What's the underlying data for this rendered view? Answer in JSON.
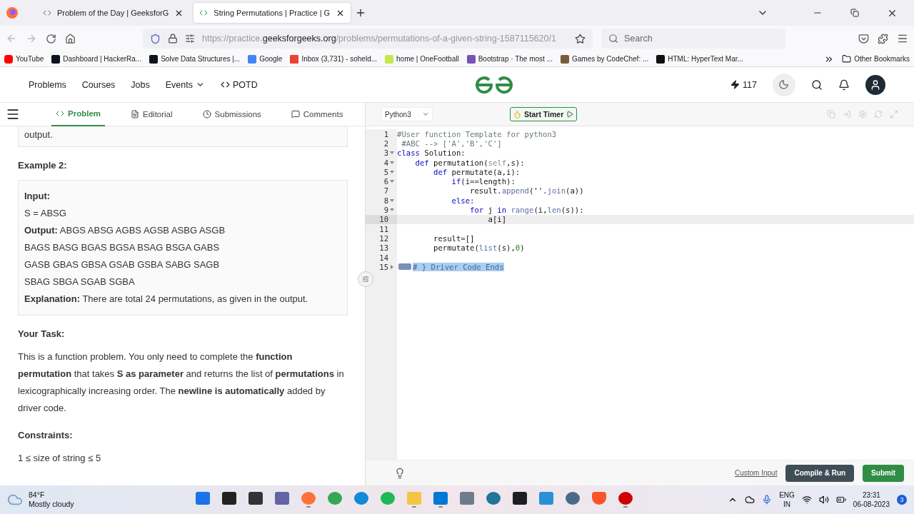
{
  "browser": {
    "tabs": [
      {
        "title": "Problem of the Day | GeeksforG",
        "selected": false
      },
      {
        "title": "String Permutations | Practice | G",
        "selected": true
      }
    ],
    "url": {
      "scheme": "https://practice.",
      "domain": "geeksforgeeks.org",
      "path": "/problems/permutations-of-a-given-string-1587115620/1"
    },
    "search_placeholder": "Search",
    "bookmarks": [
      {
        "label": "YouTube",
        "color": "#ff0000",
        "kind": "play"
      },
      {
        "label": "Dashboard | HackerRa...",
        "color": "#0e141e",
        "kind": "letter"
      },
      {
        "label": "Solve Data Structures |...",
        "color": "#0e141e",
        "kind": "letter"
      },
      {
        "label": "Google",
        "color": "#4285f4",
        "kind": "letter"
      },
      {
        "label": "Inbox (3,731) - soheld...",
        "color": "#ea4335",
        "kind": "mail"
      },
      {
        "label": "home | OneFootball",
        "color": "#c6e84a",
        "kind": "letter"
      },
      {
        "label": "Bootstrap · The most ...",
        "color": "#7952b3",
        "kind": "letter"
      },
      {
        "label": "Games by CodeChef: ...",
        "color": "#7b5a3a",
        "kind": "letter"
      },
      {
        "label": "HTML: HyperText Mar...",
        "color": "#111111",
        "kind": "letter"
      }
    ],
    "other_bookmarks": "Other Bookmarks"
  },
  "site_nav": {
    "links": [
      {
        "label": "Problems",
        "dropdown": false
      },
      {
        "label": "Courses",
        "dropdown": false
      },
      {
        "label": "Jobs",
        "dropdown": false
      },
      {
        "label": "Events",
        "dropdown": true
      },
      {
        "label": "POTD",
        "dropdown": false
      }
    ],
    "streak": "117"
  },
  "problem_tabs": [
    {
      "label": "Problem",
      "selected": true
    },
    {
      "label": "Editorial",
      "selected": false
    },
    {
      "label": "Submissions",
      "selected": false
    },
    {
      "label": "Comments",
      "selected": false
    }
  ],
  "problem": {
    "top_cut": "output.",
    "example_title": "Example 2:",
    "example": {
      "input_label": "Input:",
      "input": "S = ABSG",
      "output_label": "Output:",
      "output_lines": [
        "ABGS ABSG AGBS AGSB ASBG ASGB",
        "BAGS BASG BGAS BGSA BSAG BSGA GABS",
        "GASB GBAS GBSA GSAB GSBA SABG SAGB",
        "SBAG SBGA SGAB SGBA"
      ],
      "explanation_label": "Explanation:",
      "explanation": "There are total 24 permutations, as given in the output."
    },
    "task_title": "Your Task:",
    "task": "This is a function problem. You only need to complete the **function permutation** that takes **S as parameter** and returns the list of **permutations** in lexicographically increasing order. The **newline is automatically** added by driver code.",
    "constraints_title": "Constraints:",
    "constraint": "1 ≤ size of string ≤ 5"
  },
  "editor": {
    "language": "Python3",
    "timer": "Start Timer",
    "lines": [
      {
        "n": "1",
        "foldable": false,
        "active": false,
        "tokens": [
          {
            "kind": "comment",
            "t": "#User function Template for python3"
          }
        ]
      },
      {
        "n": "2",
        "foldable": false,
        "active": false,
        "tokens": [
          {
            "kind": "comment",
            "t": " #ABC --> ['A','B','C']"
          }
        ]
      },
      {
        "n": "3",
        "foldable": true,
        "folded": false,
        "active": false,
        "tokens": [
          {
            "kind": "keyword",
            "t": "class"
          },
          {
            "kind": "plain",
            "t": " Solution:"
          }
        ]
      },
      {
        "n": "4",
        "foldable": true,
        "folded": false,
        "active": false,
        "tokens": [
          {
            "kind": "keyword",
            "t": "    def"
          },
          {
            "kind": "plain",
            "t": " permutation("
          },
          {
            "kind": "self",
            "t": "self"
          },
          {
            "kind": "plain",
            "t": ",s):"
          }
        ]
      },
      {
        "n": "5",
        "foldable": true,
        "folded": false,
        "active": false,
        "tokens": [
          {
            "kind": "keyword",
            "t": "        def"
          },
          {
            "kind": "plain",
            "t": " permutate(a,i):"
          }
        ]
      },
      {
        "n": "6",
        "foldable": true,
        "folded": false,
        "active": false,
        "tokens": [
          {
            "kind": "keyword",
            "t": "            if"
          },
          {
            "kind": "plain",
            "t": "(i"
          },
          {
            "kind": "operator",
            "t": "=="
          },
          {
            "kind": "plain",
            "t": "length):"
          }
        ]
      },
      {
        "n": "7",
        "foldable": false,
        "active": false,
        "tokens": [
          {
            "kind": "plain",
            "t": "                result."
          },
          {
            "kind": "builtin",
            "t": "append"
          },
          {
            "kind": "plain",
            "t": "(''."
          },
          {
            "kind": "builtin",
            "t": "join"
          },
          {
            "kind": "plain",
            "t": "(a))"
          }
        ]
      },
      {
        "n": "8",
        "foldable": true,
        "folded": false,
        "active": false,
        "tokens": [
          {
            "kind": "keyword",
            "t": "            else"
          },
          {
            "kind": "plain",
            "t": ":"
          }
        ]
      },
      {
        "n": "9",
        "foldable": true,
        "folded": false,
        "active": false,
        "tokens": [
          {
            "kind": "keyword",
            "t": "                for"
          },
          {
            "kind": "plain",
            "t": " j "
          },
          {
            "kind": "keyword",
            "t": "in"
          },
          {
            "kind": "builtin",
            "t": " range"
          },
          {
            "kind": "plain",
            "t": "(i,"
          },
          {
            "kind": "builtin",
            "t": "len"
          },
          {
            "kind": "plain",
            "t": "(s)):"
          }
        ]
      },
      {
        "n": "10",
        "foldable": false,
        "active": true,
        "tokens": [
          {
            "kind": "plain",
            "t": "                    a[i]"
          }
        ]
      },
      {
        "n": "11",
        "foldable": false,
        "active": false
      },
      {
        "n": "12",
        "foldable": false,
        "active": false,
        "tokens": [
          {
            "kind": "plain",
            "t": "        result"
          },
          {
            "kind": "operator",
            "t": "="
          },
          {
            "kind": "plain",
            "t": "[]"
          }
        ]
      },
      {
        "n": "13",
        "foldable": false,
        "active": false,
        "tokens": [
          {
            "kind": "plain",
            "t": "        permutate("
          },
          {
            "kind": "builtin",
            "t": "list"
          },
          {
            "kind": "plain",
            "t": "(s),"
          },
          {
            "kind": "number",
            "t": "0"
          },
          {
            "kind": "plain",
            "t": ")"
          }
        ]
      },
      {
        "n": "14",
        "foldable": false,
        "active": false
      },
      {
        "n": "15",
        "foldable": true,
        "folded": true,
        "active": false,
        "tokens": [
          {
            "kind": "selection",
            "t": "# } Driver Code Ends"
          }
        ]
      }
    ]
  },
  "actions": {
    "custom_input": "Custom Input",
    "compile": "Compile & Run",
    "submit": "Submit"
  },
  "taskbar": {
    "weather": {
      "temp": "84°F",
      "text": "Mostly cloudy"
    },
    "apps": [
      {
        "kind": "start",
        "color": "#1a73e8",
        "running": false
      },
      {
        "kind": "search",
        "color": "#222222",
        "running": false
      },
      {
        "kind": "tasks",
        "color": "#333333",
        "running": false
      },
      {
        "kind": "chat",
        "color": "#6264a7",
        "running": false
      },
      {
        "kind": "browser",
        "color": "#ff7139",
        "running": true
      },
      {
        "kind": "browser",
        "color": "#34a853",
        "running": false
      },
      {
        "kind": "browser",
        "color": "#0f8ad8",
        "running": false
      },
      {
        "kind": "round",
        "color": "#1db954",
        "running": false
      },
      {
        "kind": "folder",
        "color": "#f4c542",
        "running": true
      },
      {
        "kind": "square",
        "color": "#0078d4",
        "running": true
      },
      {
        "kind": "square",
        "color": "#6e7b8b",
        "running": false
      },
      {
        "kind": "round",
        "color": "#21759b",
        "running": false
      },
      {
        "kind": "square",
        "color": "#1e1e1e",
        "running": false
      },
      {
        "kind": "square",
        "color": "#2a8fd4",
        "running": false
      },
      {
        "kind": "round",
        "color": "#4a6a8a",
        "running": false
      },
      {
        "kind": "shield",
        "color": "#fb542b",
        "running": false
      },
      {
        "kind": "record",
        "color": "#d00000",
        "running": true
      }
    ],
    "lang": "ENG",
    "region": "IN",
    "time": "23:31",
    "date": "06-08-2023",
    "badge": "3"
  }
}
